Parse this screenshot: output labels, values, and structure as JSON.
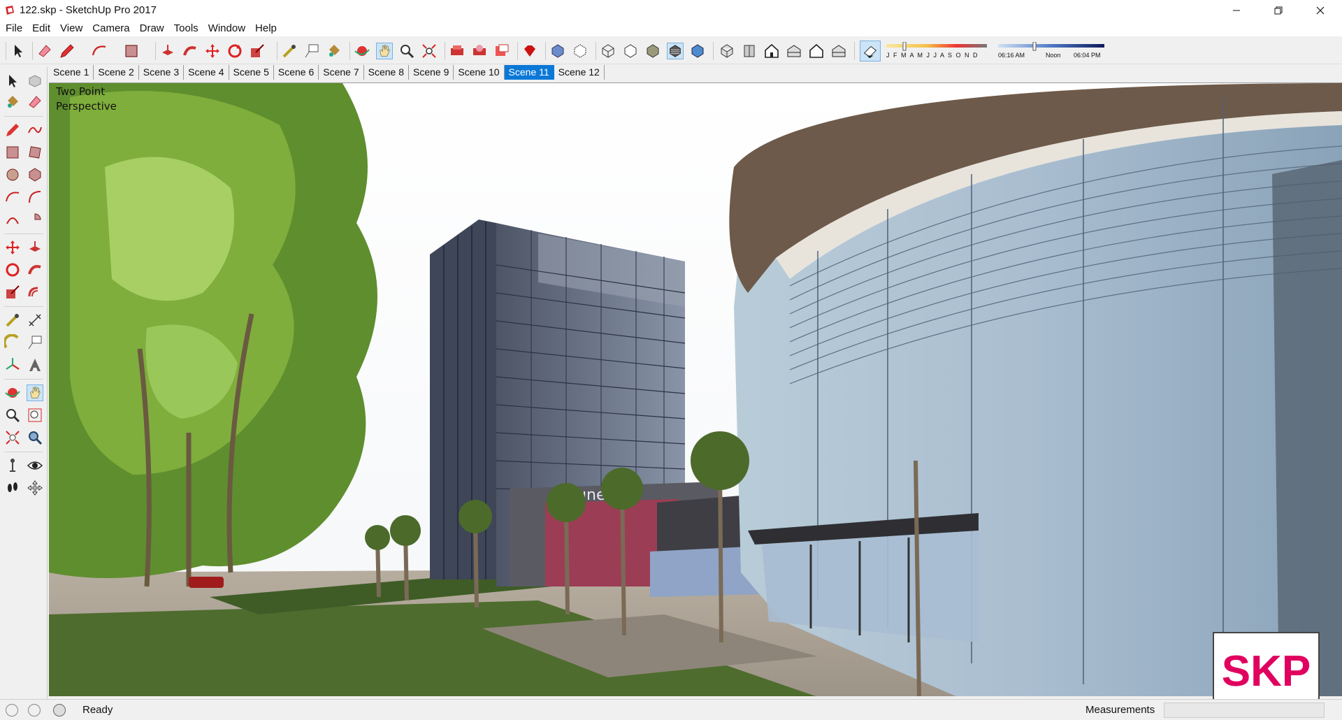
{
  "window": {
    "title": "122.skp - SketchUp Pro 2017",
    "app_icon": "sketchup-icon",
    "controls": [
      "minimize-icon",
      "restore-icon",
      "close-icon"
    ]
  },
  "menu": {
    "items": [
      "File",
      "Edit",
      "View",
      "Camera",
      "Draw",
      "Tools",
      "Window",
      "Help"
    ]
  },
  "toolbar": {
    "tools": [
      "select-icon",
      "eraser-icon",
      "pencil-icon",
      "arc-icon",
      "rectangle-icon",
      "push-pull-icon",
      "follow-me-icon",
      "move-icon",
      "rotate-icon",
      "scale-icon",
      "tape-measure-icon",
      "text-icon",
      "paint-bucket-icon",
      "orbit-icon",
      "pan-icon",
      "zoom-icon",
      "zoom-extents-icon",
      "warehouse-icon",
      "extension-warehouse-icon",
      "layout-icon",
      "ruby-icon",
      "xray-icon",
      "back-edges-icon",
      "wireframe-icon",
      "hidden-line-icon",
      "shaded-icon",
      "textured-icon",
      "monochrome-icon",
      "iso-view-icon",
      "top-view-icon",
      "front-view-icon",
      "right-view-icon",
      "back-view-icon",
      "left-view-icon"
    ],
    "active_tool": "pan-icon"
  },
  "shadows": {
    "months": "J F M A M J J A S O N D",
    "time_start": "06:16 AM",
    "time_noon": "Noon",
    "time_end": "06:04 PM"
  },
  "scenes": {
    "tabs": [
      "Scene 1",
      "Scene 2",
      "Scene 3",
      "Scene 4",
      "Scene 5",
      "Scene 6",
      "Scene 7",
      "Scene 8",
      "Scene 9",
      "Scene 10",
      "Scene 11",
      "Scene 12"
    ],
    "active": "Scene 11"
  },
  "viewport": {
    "view_label_line1": "Two Point",
    "view_label_line2": "Perspective",
    "sign_text": "Tunes G"
  },
  "logo": {
    "text": "SKP"
  },
  "status": {
    "text": "Ready",
    "measurements_label": "Measurements",
    "measurements_value": ""
  },
  "colors": {
    "active_tab": "#0a78d7",
    "logo_magenta": "#e0005f"
  }
}
